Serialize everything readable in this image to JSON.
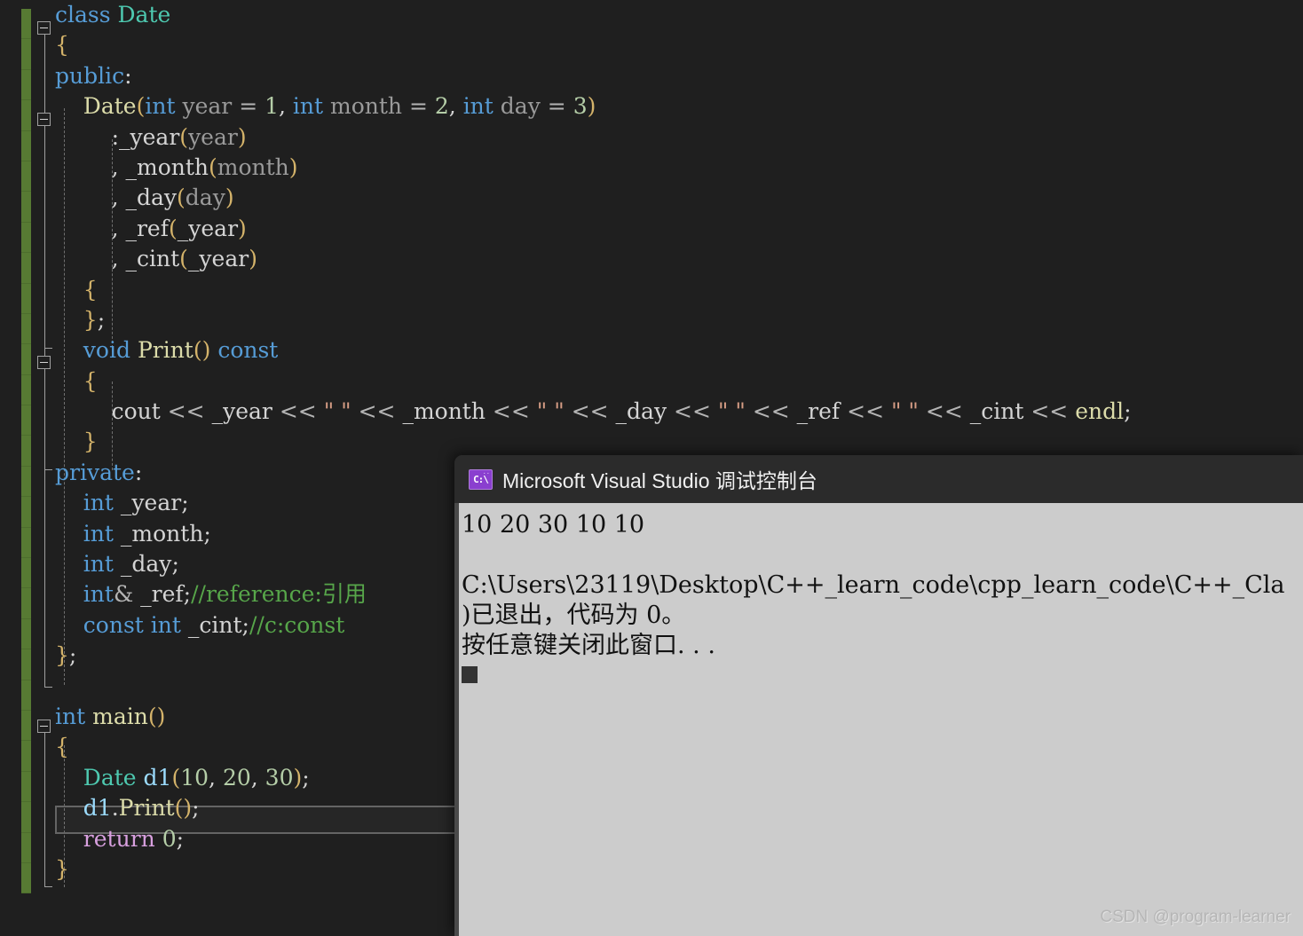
{
  "editor": {
    "theme_background": "#1f1f1f",
    "change_bar_color": "#577a33",
    "code_lines": [
      {
        "indent": 0,
        "tokens": [
          {
            "t": "class ",
            "c": "k"
          },
          {
            "t": "Date",
            "c": "typ"
          }
        ]
      },
      {
        "indent": 0,
        "tokens": [
          {
            "t": "{",
            "c": "brc"
          }
        ]
      },
      {
        "indent": 0,
        "tokens": [
          {
            "t": "public",
            "c": "k"
          },
          {
            "t": ":",
            "c": "plain"
          }
        ]
      },
      {
        "indent": 1,
        "tokens": [
          {
            "t": "Date",
            "c": "fn"
          },
          {
            "t": "(",
            "c": "brc"
          },
          {
            "t": "int",
            "c": "k"
          },
          {
            "t": " year ",
            "c": "gray"
          },
          {
            "t": "=",
            "c": "op"
          },
          {
            "t": " ",
            "c": "plain"
          },
          {
            "t": "1",
            "c": "num"
          },
          {
            "t": ", ",
            "c": "plain"
          },
          {
            "t": "int",
            "c": "k"
          },
          {
            "t": " month ",
            "c": "gray"
          },
          {
            "t": "=",
            "c": "op"
          },
          {
            "t": " ",
            "c": "plain"
          },
          {
            "t": "2",
            "c": "num"
          },
          {
            "t": ", ",
            "c": "plain"
          },
          {
            "t": "int",
            "c": "k"
          },
          {
            "t": " day ",
            "c": "gray"
          },
          {
            "t": "=",
            "c": "op"
          },
          {
            "t": " ",
            "c": "plain"
          },
          {
            "t": "3",
            "c": "num"
          },
          {
            "t": ")",
            "c": "brc"
          }
        ]
      },
      {
        "indent": 2,
        "tokens": [
          {
            "t": ":",
            "c": "plain"
          },
          {
            "t": "_year",
            "c": "plain"
          },
          {
            "t": "(",
            "c": "brc"
          },
          {
            "t": "year",
            "c": "gray"
          },
          {
            "t": ")",
            "c": "brc"
          }
        ]
      },
      {
        "indent": 2,
        "tokens": [
          {
            "t": ", ",
            "c": "plain"
          },
          {
            "t": "_month",
            "c": "plain"
          },
          {
            "t": "(",
            "c": "brc"
          },
          {
            "t": "month",
            "c": "gray"
          },
          {
            "t": ")",
            "c": "brc"
          }
        ]
      },
      {
        "indent": 2,
        "tokens": [
          {
            "t": ", ",
            "c": "plain"
          },
          {
            "t": "_day",
            "c": "plain"
          },
          {
            "t": "(",
            "c": "brc"
          },
          {
            "t": "day",
            "c": "gray"
          },
          {
            "t": ")",
            "c": "brc"
          }
        ]
      },
      {
        "indent": 2,
        "tokens": [
          {
            "t": ", ",
            "c": "plain"
          },
          {
            "t": "_ref",
            "c": "plain"
          },
          {
            "t": "(",
            "c": "brc"
          },
          {
            "t": "_year",
            "c": "plain"
          },
          {
            "t": ")",
            "c": "brc"
          }
        ]
      },
      {
        "indent": 2,
        "tokens": [
          {
            "t": ", ",
            "c": "plain"
          },
          {
            "t": "_cint",
            "c": "plain"
          },
          {
            "t": "(",
            "c": "brc"
          },
          {
            "t": "_year",
            "c": "plain"
          },
          {
            "t": ")",
            "c": "brc"
          }
        ]
      },
      {
        "indent": 1,
        "tokens": [
          {
            "t": "{",
            "c": "brc"
          }
        ]
      },
      {
        "indent": 1,
        "tokens": [
          {
            "t": "}",
            "c": "brc"
          },
          {
            "t": ";",
            "c": "plain"
          }
        ]
      },
      {
        "indent": 1,
        "tokens": [
          {
            "t": "void",
            "c": "k"
          },
          {
            "t": " ",
            "c": "plain"
          },
          {
            "t": "Print",
            "c": "fn"
          },
          {
            "t": "()",
            "c": "brc"
          },
          {
            "t": " ",
            "c": "plain"
          },
          {
            "t": "const",
            "c": "k"
          }
        ]
      },
      {
        "indent": 1,
        "tokens": [
          {
            "t": "{",
            "c": "brc"
          }
        ]
      },
      {
        "indent": 2,
        "tokens": [
          {
            "t": "cout",
            "c": "plain"
          },
          {
            "t": " ",
            "c": "plain"
          },
          {
            "t": "<<",
            "c": "op"
          },
          {
            "t": " ",
            "c": "plain"
          },
          {
            "t": "_year",
            "c": "plain"
          },
          {
            "t": " ",
            "c": "plain"
          },
          {
            "t": "<<",
            "c": "op"
          },
          {
            "t": " ",
            "c": "plain"
          },
          {
            "t": "\" \"",
            "c": "str"
          },
          {
            "t": " ",
            "c": "plain"
          },
          {
            "t": "<<",
            "c": "op"
          },
          {
            "t": " ",
            "c": "plain"
          },
          {
            "t": "_month",
            "c": "plain"
          },
          {
            "t": " ",
            "c": "plain"
          },
          {
            "t": "<<",
            "c": "op"
          },
          {
            "t": " ",
            "c": "plain"
          },
          {
            "t": "\" \"",
            "c": "str"
          },
          {
            "t": " ",
            "c": "plain"
          },
          {
            "t": "<<",
            "c": "op"
          },
          {
            "t": " ",
            "c": "plain"
          },
          {
            "t": "_day",
            "c": "plain"
          },
          {
            "t": " ",
            "c": "plain"
          },
          {
            "t": "<<",
            "c": "op"
          },
          {
            "t": " ",
            "c": "plain"
          },
          {
            "t": "\" \"",
            "c": "str"
          },
          {
            "t": " ",
            "c": "plain"
          },
          {
            "t": "<<",
            "c": "op"
          },
          {
            "t": " ",
            "c": "plain"
          },
          {
            "t": "_ref",
            "c": "plain"
          },
          {
            "t": " ",
            "c": "plain"
          },
          {
            "t": "<<",
            "c": "op"
          },
          {
            "t": " ",
            "c": "plain"
          },
          {
            "t": "\" \"",
            "c": "str"
          },
          {
            "t": " ",
            "c": "plain"
          },
          {
            "t": "<<",
            "c": "op"
          },
          {
            "t": " ",
            "c": "plain"
          },
          {
            "t": "_cint",
            "c": "plain"
          },
          {
            "t": " ",
            "c": "plain"
          },
          {
            "t": "<<",
            "c": "op"
          },
          {
            "t": " ",
            "c": "plain"
          },
          {
            "t": "endl",
            "c": "fn"
          },
          {
            "t": ";",
            "c": "plain"
          }
        ]
      },
      {
        "indent": 1,
        "tokens": [
          {
            "t": "}",
            "c": "brc"
          }
        ]
      },
      {
        "indent": 0,
        "tokens": [
          {
            "t": "private",
            "c": "k"
          },
          {
            "t": ":",
            "c": "plain"
          }
        ]
      },
      {
        "indent": 1,
        "tokens": [
          {
            "t": "int",
            "c": "k"
          },
          {
            "t": " _year",
            "c": "plain"
          },
          {
            "t": ";",
            "c": "plain"
          }
        ]
      },
      {
        "indent": 1,
        "tokens": [
          {
            "t": "int",
            "c": "k"
          },
          {
            "t": " _month",
            "c": "plain"
          },
          {
            "t": ";",
            "c": "plain"
          }
        ]
      },
      {
        "indent": 1,
        "tokens": [
          {
            "t": "int",
            "c": "k"
          },
          {
            "t": " _day",
            "c": "plain"
          },
          {
            "t": ";",
            "c": "plain"
          }
        ]
      },
      {
        "indent": 1,
        "tokens": [
          {
            "t": "int",
            "c": "k"
          },
          {
            "t": "&",
            "c": "op"
          },
          {
            "t": " _ref",
            "c": "plain"
          },
          {
            "t": ";",
            "c": "plain"
          },
          {
            "t": "//reference:引用",
            "c": "cmt"
          }
        ]
      },
      {
        "indent": 1,
        "tokens": [
          {
            "t": "const",
            "c": "k"
          },
          {
            "t": " ",
            "c": "plain"
          },
          {
            "t": "int",
            "c": "k"
          },
          {
            "t": " _cint",
            "c": "plain"
          },
          {
            "t": ";",
            "c": "plain"
          },
          {
            "t": "//c:const",
            "c": "cmt"
          }
        ]
      },
      {
        "indent": 0,
        "tokens": [
          {
            "t": "}",
            "c": "brc"
          },
          {
            "t": ";",
            "c": "plain"
          }
        ]
      },
      {
        "indent": 0,
        "tokens": []
      },
      {
        "indent": 0,
        "tokens": [
          {
            "t": "int",
            "c": "k"
          },
          {
            "t": " ",
            "c": "plain"
          },
          {
            "t": "main",
            "c": "fn"
          },
          {
            "t": "()",
            "c": "brc"
          }
        ]
      },
      {
        "indent": 0,
        "tokens": [
          {
            "t": "{",
            "c": "brc"
          }
        ]
      },
      {
        "indent": 1,
        "tokens": [
          {
            "t": "Date",
            "c": "typ"
          },
          {
            "t": " ",
            "c": "plain"
          },
          {
            "t": "d1",
            "c": "var"
          },
          {
            "t": "(",
            "c": "brc"
          },
          {
            "t": "10",
            "c": "num"
          },
          {
            "t": ", ",
            "c": "plain"
          },
          {
            "t": "20",
            "c": "num"
          },
          {
            "t": ", ",
            "c": "plain"
          },
          {
            "t": "30",
            "c": "num"
          },
          {
            "t": ")",
            "c": "brc"
          },
          {
            "t": ";",
            "c": "plain"
          }
        ]
      },
      {
        "indent": 1,
        "tokens": [
          {
            "t": "d1",
            "c": "var"
          },
          {
            "t": ".",
            "c": "plain"
          },
          {
            "t": "Print",
            "c": "fn"
          },
          {
            "t": "()",
            "c": "brc"
          },
          {
            "t": ";",
            "c": "plain"
          }
        ]
      },
      {
        "indent": 1,
        "tokens": [
          {
            "t": "return",
            "c": "ctl"
          },
          {
            "t": " ",
            "c": "plain"
          },
          {
            "t": "0",
            "c": "num"
          },
          {
            "t": ";",
            "c": "plain"
          }
        ]
      },
      {
        "indent": 0,
        "tokens": [
          {
            "t": "}",
            "c": "brc"
          }
        ]
      }
    ],
    "current_line_index": 26
  },
  "console": {
    "title": "Microsoft Visual Studio 调试控制台",
    "icon_name": "cmd-prompt-icon",
    "icon_glyph": "C:\\",
    "output_lines": [
      "10 20 30 10 10",
      "",
      "C:\\Users\\23119\\Desktop\\C++_learn_code\\cpp_learn_code\\C++_Cla",
      ")已退出，代码为 0。",
      "按任意键关闭此窗口. . ."
    ]
  },
  "watermark": {
    "text": "CSDN @program-learner"
  }
}
